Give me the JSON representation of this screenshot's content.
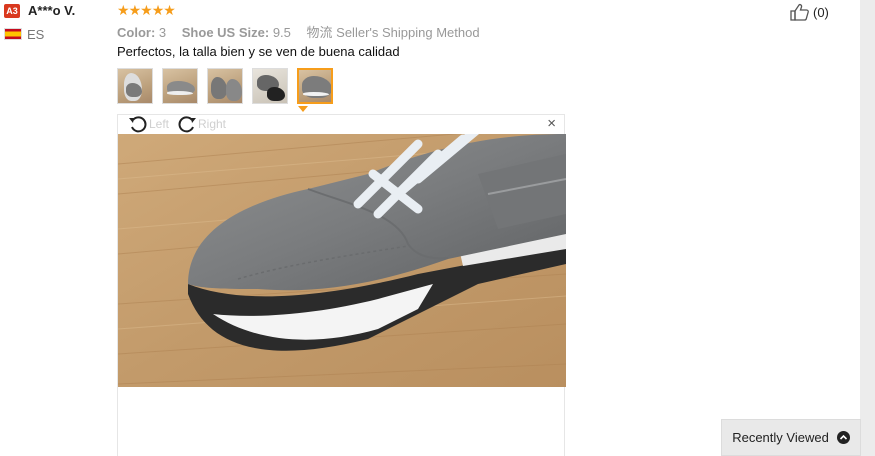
{
  "reviewer": {
    "level_badge": "A3",
    "name": "A***o V.",
    "country": "ES",
    "flag_icon": "spain-flag-icon"
  },
  "rating": {
    "stars": 5,
    "max": 5,
    "color": "#f69d1b"
  },
  "attributes": {
    "color_label": "Color:",
    "color_value": "3",
    "size_label": "Shoe US Size:",
    "size_value": "9.5",
    "shipping_label": "物流",
    "shipping_value": "Seller's Shipping Method"
  },
  "review_text": "Perfectos, la talla bien y se ven de buena calidad",
  "helpful": {
    "icon": "thumbs-up-icon",
    "count_text": "(0)"
  },
  "thumbnails": [
    {
      "id": "photo-1",
      "active": false
    },
    {
      "id": "photo-2",
      "active": false
    },
    {
      "id": "photo-3",
      "active": false
    },
    {
      "id": "photo-4",
      "active": false
    },
    {
      "id": "photo-5",
      "active": true
    }
  ],
  "viewer": {
    "rotate_left_label": "Left",
    "rotate_right_label": "Right",
    "close_label": "×"
  },
  "recently_viewed": {
    "label": "Recently Viewed",
    "icon": "chevron-up-icon"
  },
  "colors": {
    "badge": "#d9381e",
    "accent": "#f69d1b"
  }
}
